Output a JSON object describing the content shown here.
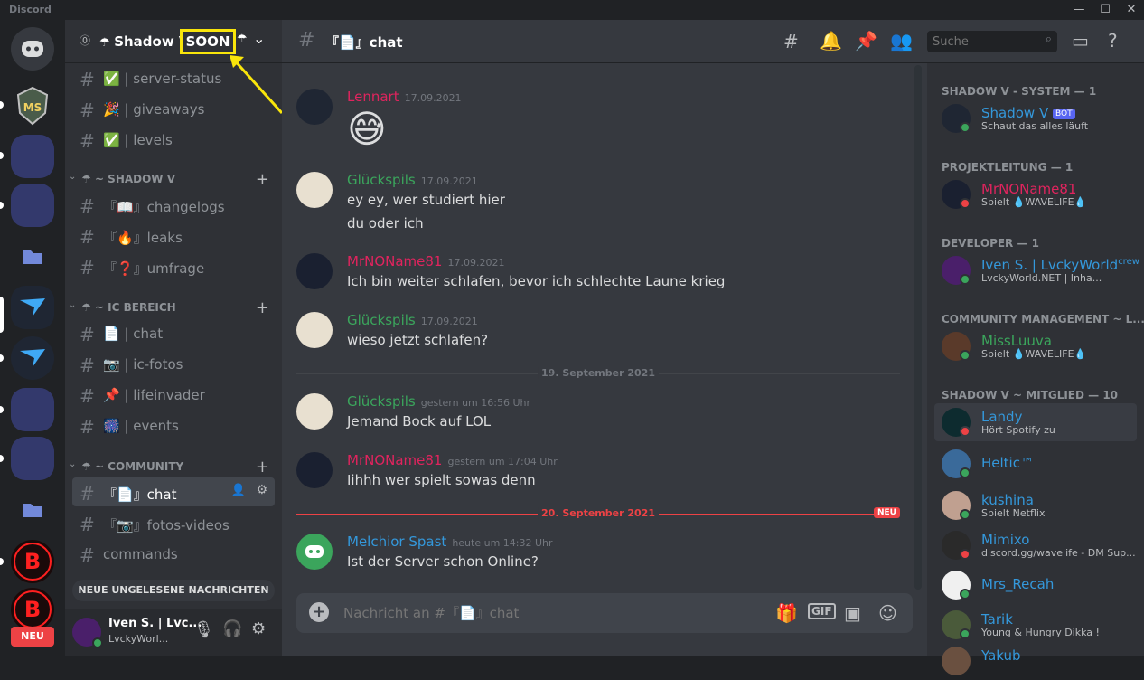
{
  "app": {
    "title": "Discord"
  },
  "server": {
    "name": "Shadow V",
    "annotation": "SOON"
  },
  "sidebar": {
    "channels_top": [
      {
        "emoji": "✅",
        "label": "| server-status"
      },
      {
        "emoji": "🎉",
        "label": "| giveaways"
      },
      {
        "emoji": "✅",
        "label": "| levels"
      }
    ],
    "cat1": "~ SHADOW V",
    "cat1_channels": [
      {
        "emoji": "📖",
        "label": "『📖』changelogs"
      },
      {
        "emoji": "🔥",
        "label": "『🔥』leaks"
      },
      {
        "emoji": "❓",
        "label": "『❓』umfrage"
      }
    ],
    "cat2": "~ IC BEREICH",
    "cat2_channels": [
      {
        "emoji": "📄",
        "label": "| chat"
      },
      {
        "emoji": "📷",
        "label": "| ic-fotos"
      },
      {
        "emoji": "📌",
        "label": "| lifeinvader"
      },
      {
        "emoji": "🎆",
        "label": "| events"
      }
    ],
    "cat3": "~ COMMUNITY",
    "cat3_channels": [
      {
        "label": "『📄』chat",
        "active": true
      },
      {
        "label": "『📷』fotos-videos"
      },
      {
        "label": "commands"
      }
    ],
    "unread": "NEUE UNGELESENE NACHRICHTEN",
    "user": {
      "name": "Iven S. | Lvc...",
      "status": "LvckyWorl..."
    }
  },
  "guild_rail": {
    "new_badge": "NEU"
  },
  "chat": {
    "channel_name": "『📄』chat",
    "search_placeholder": "Suche",
    "messages": [
      {
        "author": "Lennart",
        "color": "#e0245e",
        "time": "17.09.2021",
        "lines": [
          "😅"
        ]
      },
      {
        "author": "Glückspils",
        "color": "#3ba55c",
        "time": "17.09.2021",
        "lines": [
          "ey ey, wer studiert hier",
          "du oder ich"
        ]
      },
      {
        "author": "MrNOName81",
        "color": "#e0245e",
        "time": "17.09.2021",
        "lines": [
          "Ich bin weiter schlafen, bevor ich schlechte Laune krieg"
        ]
      },
      {
        "author": "Glückspils",
        "color": "#3ba55c",
        "time": "17.09.2021",
        "lines": [
          "wieso jetzt schlafen?"
        ]
      },
      {
        "author": "Glückspils",
        "color": "#3ba55c",
        "time": "gestern um 16:56 Uhr",
        "lines": [
          "Jemand Bock auf LOL"
        ]
      },
      {
        "author": "MrNOName81",
        "color": "#e0245e",
        "time": "gestern um 17:04 Uhr",
        "lines": [
          "Iihhh wer spielt sowas denn"
        ]
      },
      {
        "author": "Melchior Spast",
        "color": "#3498db",
        "time": "heute um 14:32 Uhr",
        "lines": [
          "Ist der Server schon Online?"
        ]
      }
    ],
    "divider1": "19. September 2021",
    "divider2": "20. September 2021",
    "new_label": "NEU",
    "composer_placeholder": "Nachricht an #『📄』chat"
  },
  "members": {
    "groups": [
      {
        "title": "SHADOW V - SYSTEM — 1"
      },
      {
        "title": "PROJEKTLEITUNG — 1"
      },
      {
        "title": "DEVELOPER — 1"
      },
      {
        "title": "COMMUNITY MANAGEMENT ~ L..."
      },
      {
        "title": "SHADOW V ~ MITGLIED — 10"
      }
    ],
    "list": [
      {
        "name": "Shadow V",
        "color": "#3498db",
        "badge": "BOT",
        "status": "Schaut das alles läuft"
      },
      {
        "name": "MrNOName81",
        "color": "#e0245e",
        "status": "Spielt 💧WAVELIFE💧"
      },
      {
        "name": "Iven S. | LvckyWorld",
        "sup": "crew",
        "color": "#3498db",
        "status": "LvckyWorld.NET | Inha..."
      },
      {
        "name": "MissLuuva",
        "color": "#3ba55c",
        "status": "Spielt 💧WAVELIFE💧"
      },
      {
        "name": "Landy",
        "color": "#3498db",
        "status": "Hört Spotify zu"
      },
      {
        "name": "Heltic™",
        "color": "#3498db",
        "status": ""
      },
      {
        "name": "kushina",
        "color": "#3498db",
        "status": "Spielt Netflix"
      },
      {
        "name": "Mimixo",
        "color": "#3498db",
        "status": "discord.gg/wavelife - DM Sup..."
      },
      {
        "name": "Mrs_Recah",
        "color": "#3498db",
        "status": ""
      },
      {
        "name": "Tarik",
        "color": "#3498db",
        "status": "Young & Hungry Dikka !"
      },
      {
        "name": "Yakub",
        "color": "#3498db",
        "status": ""
      }
    ]
  }
}
